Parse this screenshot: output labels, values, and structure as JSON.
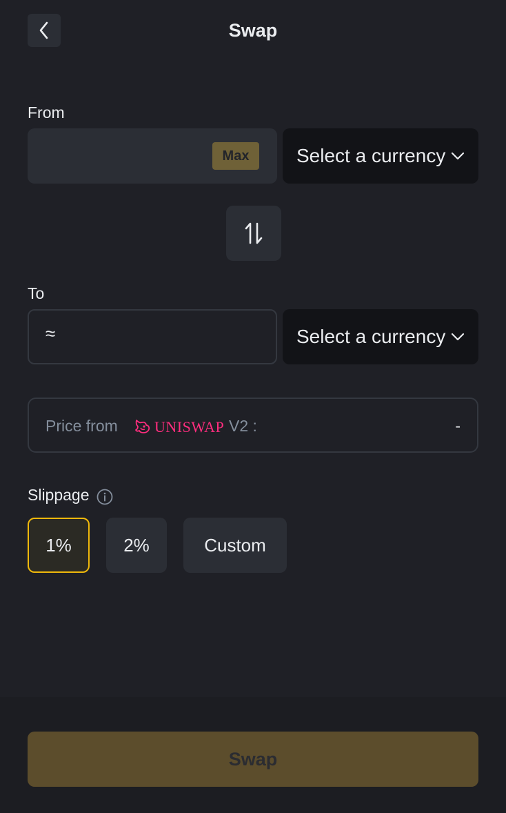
{
  "header": {
    "title": "Swap",
    "back_icon": "chevron-left-icon"
  },
  "from": {
    "label": "From",
    "amount_value": "",
    "max_label": "Max",
    "currency_select_label": "Select a currency"
  },
  "to": {
    "label": "To",
    "approx_symbol": "≈",
    "currency_select_label": "Select a currency"
  },
  "swap_direction_icon": "swap-vertical-arrows-icon",
  "price": {
    "prefix": "Price from",
    "source_name": "UNISWAP",
    "version": "V2 :",
    "value": "-"
  },
  "slippage": {
    "label": "Slippage",
    "info_icon": "info-icon",
    "options": [
      "1%",
      "2%",
      "Custom"
    ],
    "selected": "1%"
  },
  "actions": {
    "swap_label": "Swap"
  },
  "colors": {
    "background": "#1f2026",
    "surface": "#2b2e35",
    "select_bg": "#121317",
    "accent": "#f0b90b",
    "swap_button_disabled": "#5c4d2c",
    "max_button": "#6f6137",
    "uniswap_pink": "#ff2d7e",
    "muted_text": "#848e9c"
  }
}
